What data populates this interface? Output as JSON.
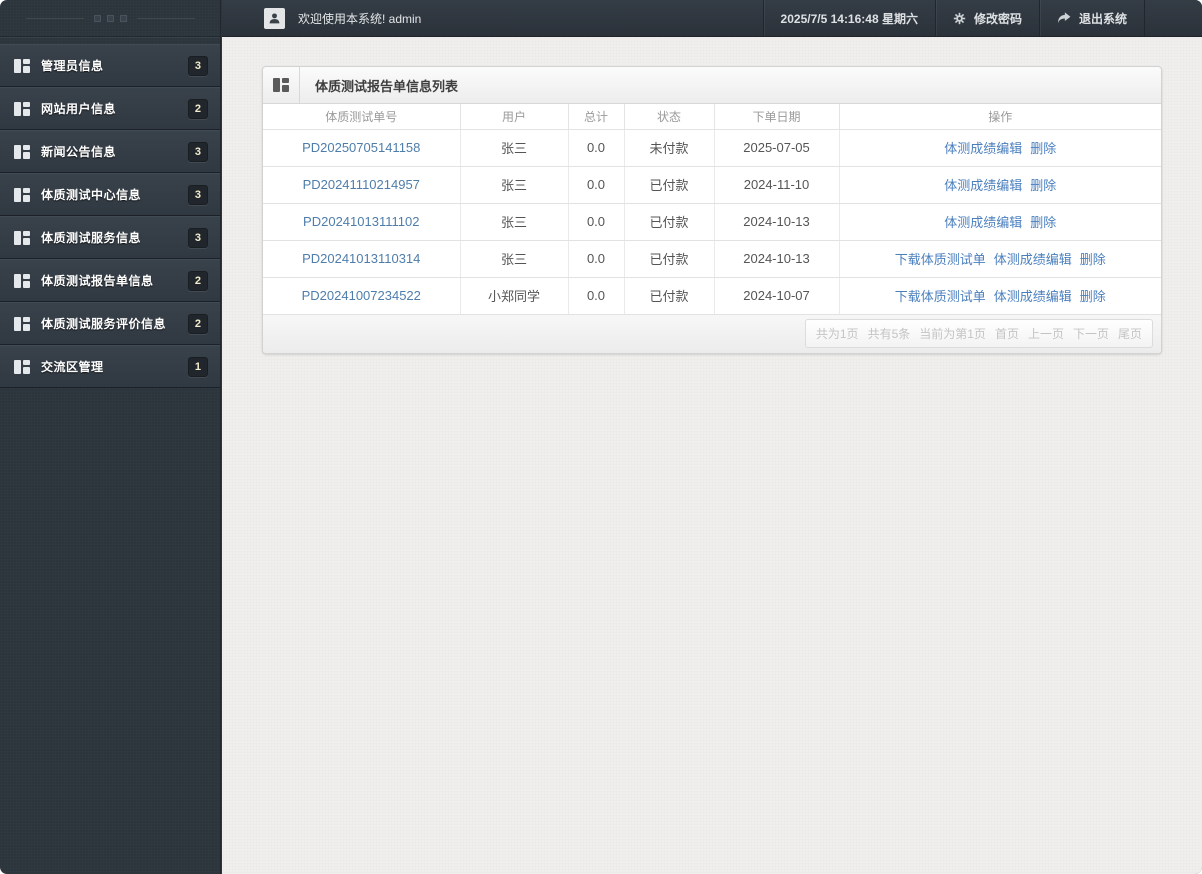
{
  "colors": {
    "frame_dark": "#2c343c",
    "content_bg": "#f0efed",
    "order_link": "#4f7dab",
    "action_link": "#4a7fbe",
    "badge_text": "#f2ecca"
  },
  "icons": {
    "sidebar_item": "grid-icon",
    "panel_title": "grid-icon",
    "welcome_user": "person-icon",
    "change_password": "gear-icon",
    "logout": "forward-arrow-icon",
    "sidebar_handle": "three-squares-handle"
  },
  "sidebar": {
    "items": [
      {
        "label": "管理员信息",
        "badge": "3"
      },
      {
        "label": "网站用户信息",
        "badge": "2"
      },
      {
        "label": "新闻公告信息",
        "badge": "3"
      },
      {
        "label": "体质测试中心信息",
        "badge": "3"
      },
      {
        "label": "体质测试服务信息",
        "badge": "3"
      },
      {
        "label": "体质测试报告单信息",
        "badge": "2"
      },
      {
        "label": "体质测试服务评价信息",
        "badge": "2"
      },
      {
        "label": "交流区管理",
        "badge": "1"
      }
    ]
  },
  "header": {
    "welcome": "欢迎使用本系统! admin",
    "datetime": "2025/7/5 14:16:48 星期六",
    "change_password": "修改密码",
    "logout": "退出系统"
  },
  "panel": {
    "title": "体质测试报告单信息列表",
    "table": {
      "columns": [
        "体质测试单号",
        "用户",
        "总计",
        "状态",
        "下单日期",
        "操作"
      ],
      "rows": [
        {
          "order_no": "PD20250705141158",
          "user": "张三",
          "total": "0.0",
          "status": "未付款",
          "date": "2025-07-05",
          "actions": [
            "体测成绩编辑",
            "删除"
          ]
        },
        {
          "order_no": "PD20241110214957",
          "user": "张三",
          "total": "0.0",
          "status": "已付款",
          "date": "2024-11-10",
          "actions": [
            "体测成绩编辑",
            "删除"
          ]
        },
        {
          "order_no": "PD20241013111102",
          "user": "张三",
          "total": "0.0",
          "status": "已付款",
          "date": "2024-10-13",
          "actions": [
            "体测成绩编辑",
            "删除"
          ]
        },
        {
          "order_no": "PD20241013110314",
          "user": "张三",
          "total": "0.0",
          "status": "已付款",
          "date": "2024-10-13",
          "actions": [
            "下载体质测试单",
            "体测成绩编辑",
            "删除"
          ]
        },
        {
          "order_no": "PD20241007234522",
          "user": "小郑同学",
          "total": "0.0",
          "status": "已付款",
          "date": "2024-10-07",
          "actions": [
            "下载体质测试单",
            "体测成绩编辑",
            "删除"
          ]
        }
      ]
    },
    "pagination": {
      "info": [
        "共为1页",
        "共有5条",
        "当前为第1页"
      ],
      "links": [
        "首页",
        "上一页",
        "下一页",
        "尾页"
      ]
    }
  }
}
